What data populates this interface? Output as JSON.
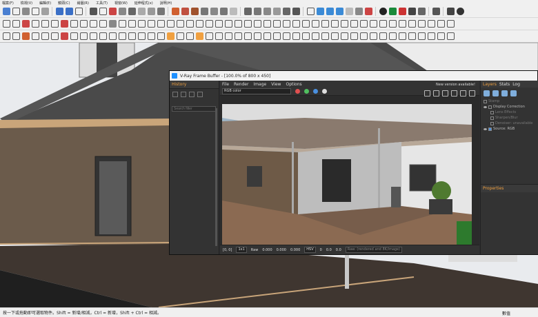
{
  "menu": [
    "檔案(F)",
    "檢視(V)",
    "編輯(E)",
    "鏡頭(C)",
    "繪圖(R)",
    "工具(T)",
    "視窗(W)",
    "延伸程式(x)",
    "說明(H)"
  ],
  "vfb": {
    "title": "V-Ray Frame Buffer - [100.0% of 800 x 450]",
    "history_title": "History",
    "search_placeholder": "Search filter",
    "menu": [
      "File",
      "Render",
      "Image",
      "View",
      "Options"
    ],
    "channel": "RGB color",
    "update_notice": "New version available!",
    "layers_tab": "Layers",
    "stats_tab": "Stats",
    "log_tab": "Log",
    "layers": [
      {
        "name": "Stamp",
        "dim": true
      },
      {
        "name": "Display Correction",
        "dim": false
      },
      {
        "name": "Lens Effects",
        "dim": true
      },
      {
        "name": "Sharpen/Blur",
        "dim": true
      },
      {
        "name": "Denoiser: unavailable",
        "dim": true
      },
      {
        "name": "Source: RGB",
        "dim": false
      }
    ],
    "properties_title": "Properties",
    "coords": "[0, 0]",
    "zoom": "1x1",
    "raw_label": "Raw",
    "raw_values": [
      "0.000",
      "0.000",
      "0.000"
    ],
    "color_mode": "HSV",
    "hsv_values": [
      "0",
      "0.0",
      "0.0"
    ],
    "progress": "Rate: ...",
    "footer_notice": "Raw: (rendered and 8K/image)"
  },
  "status": {
    "hint": "按一下或拖動即可選取物件。Shift = 新增/相減，Ctrl = 新增，Shift + Ctrl = 相減。",
    "right_label": "數值"
  },
  "colors": {
    "accent": "#f0a040",
    "vray_panel": "#333333",
    "wood": "#6a5a4a",
    "roof": "#4a4a4a",
    "deck": "#3f3630"
  }
}
